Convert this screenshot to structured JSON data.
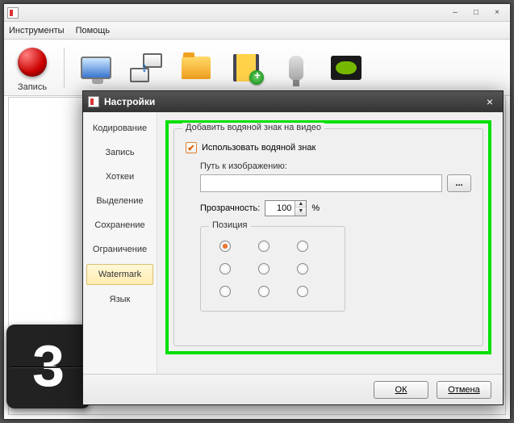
{
  "window": {
    "minimize": "–",
    "maximize": "□",
    "close": "×"
  },
  "menu": {
    "instruments": "Инструменты",
    "help": "Помощь"
  },
  "toolbar": {
    "record": "Запись"
  },
  "countdown": {
    "digit": "3"
  },
  "dialog": {
    "title": "Настройки",
    "close": "×",
    "tabs": {
      "encoding": "Кодирование",
      "record": "Запись",
      "hotkeys": "Хоткеи",
      "selection": "Выделение",
      "saving": "Сохранение",
      "restriction": "Ограничение",
      "watermark": "Watermark",
      "language": "Язык"
    },
    "watermark": {
      "groupTitle": "Добавить водяной знак на видео",
      "useLabel": "Использовать водяной знак",
      "pathLabel": "Путь к изображению:",
      "pathValue": "",
      "browse": "...",
      "opacityLabel": "Прозрачность:",
      "opacityValue": "100",
      "opacityUnit": "%",
      "positionLabel": "Позиция"
    },
    "buttons": {
      "ok": "ОК",
      "cancel": "Отмена"
    }
  }
}
